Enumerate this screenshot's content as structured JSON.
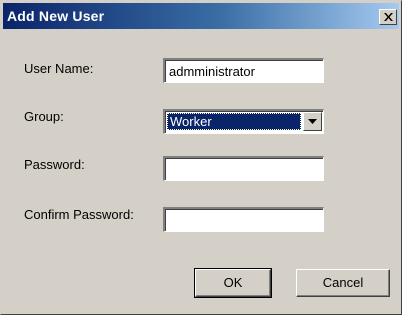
{
  "window": {
    "title": "Add New User",
    "close_icon": "close-icon"
  },
  "form": {
    "username": {
      "label": "User Name:",
      "value": "admministrator"
    },
    "group": {
      "label": "Group:",
      "selected": "Worker",
      "dropdown_icon": "chevron-down-icon"
    },
    "password": {
      "label": "Password:",
      "value": ""
    },
    "confirm_password": {
      "label": "Confirm Password:",
      "value": ""
    }
  },
  "buttons": {
    "ok": "OK",
    "cancel": "Cancel"
  },
  "colors": {
    "titlebar_start": "#0a246a",
    "titlebar_end": "#a6caf0",
    "face": "#d4d0c8",
    "selection": "#0a246a"
  }
}
